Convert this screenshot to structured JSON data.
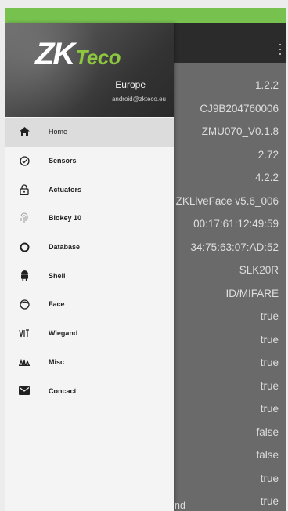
{
  "drawer": {
    "brand_primary": "ZK",
    "brand_secondary": "Teco",
    "region": "Europe",
    "email": "android@zkteco.eu",
    "items": [
      {
        "label": "Home",
        "icon": "home-icon",
        "active": true
      },
      {
        "label": "Sensors",
        "icon": "check-circle-icon"
      },
      {
        "label": "Actuators",
        "icon": "lock-icon"
      },
      {
        "label": "Biokey 10",
        "icon": "fingerprint-icon"
      },
      {
        "label": "Database",
        "icon": "ring-icon"
      },
      {
        "label": "Shell",
        "icon": "android-icon"
      },
      {
        "label": "Face",
        "icon": "face-icon"
      },
      {
        "label": "Wiegand",
        "icon": "wiegand-icon"
      },
      {
        "label": "Misc",
        "icon": "misc-icon"
      },
      {
        "label": "Concact",
        "icon": "mail-icon"
      }
    ]
  },
  "values": [
    "1.2.2",
    "CJ9B204760006",
    "ZMU070_V0.1.8",
    "2.72",
    "4.2.2",
    "ZKLiveFace v5.6_006",
    "00:17:61:12:49:59",
    "34:75:63:07:AD:52",
    "SLK20R",
    "ID/MIFARE",
    "true",
    "true",
    "true",
    "true",
    "true",
    "false",
    "false",
    "true",
    "true"
  ],
  "bottom_fragment": "nd",
  "colors": {
    "status_bar": "#77c14f",
    "app_bar": "#2b2b2b",
    "brand_green": "#8dc63f"
  }
}
